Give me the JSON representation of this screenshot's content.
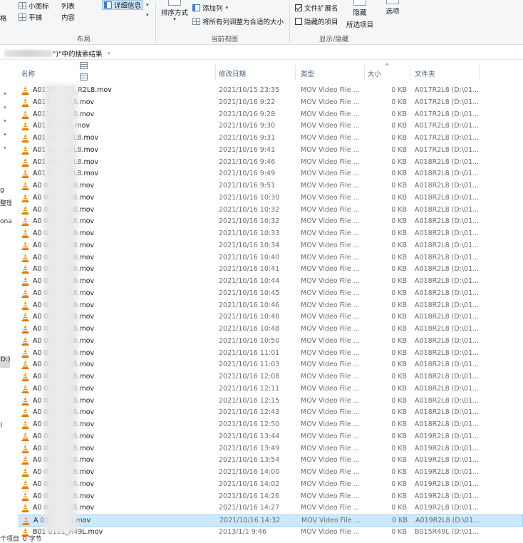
{
  "ribbon": {
    "layout_group": {
      "label": "布局",
      "small_icons": "小图标",
      "list": "列表",
      "details": "详细信息",
      "tiles": "平铺",
      "content": "内容",
      "partial_left": "格"
    },
    "current_view_group": {
      "label": "当前视图",
      "sort_by": "排序方式",
      "add_columns": "添加列",
      "size_all_columns": "将所有列调整为合适的大小"
    },
    "show_hide_group": {
      "label": "显示/隐藏",
      "file_extensions": "文件扩展名",
      "file_extensions_checked": true,
      "hidden_items": "隐藏的项目",
      "hidden_items_checked": false,
      "hide_selected": "隐藏",
      "hide_selected_sub": "所选项目",
      "options": "选项"
    }
  },
  "address": {
    "text": "\")\"中的搜索结果",
    "separator": "›"
  },
  "nav": {
    "partial_labels": [
      "g",
      "整理",
      "ona",
      "D:)",
      ")"
    ]
  },
  "columns": {
    "name": "名称",
    "date": "修改日期",
    "type": "类型",
    "size": "大小",
    "folder": "文件夹",
    "sort_indicator": "^"
  },
  "rows": [
    {
      "name": "A017C0   015_R2L8.mov",
      "date": "2021/10/15 23:35",
      "type": "MOV Video File ...",
      "size": "0 KB",
      "folder": "A017R2L8 (D:\\01..."
    },
    {
      "name": "A017   6_R2L8.mov",
      "date": "2021/10/16 9:22",
      "type": "MOV Video File ...",
      "size": "0 KB",
      "folder": "A017R2L8 (D:\\01..."
    },
    {
      "name": "A017   6_R2L8.mov",
      "date": "2021/10/16 9:28",
      "type": "MOV Video File ...",
      "size": "0 KB",
      "folder": "A017R2L8 (D:\\01..."
    },
    {
      "name": "A01   6_R2L8.mov",
      "date": "2021/10/16 9:30",
      "type": "MOV Video File ...",
      "size": "0 KB",
      "folder": "A017R2L8 (D:\\01..."
    },
    {
      "name": "A01   016_R2L8.mov",
      "date": "2021/10/16 9:31",
      "type": "MOV Video File ...",
      "size": "0 KB",
      "folder": "A017R2L8 (D:\\01..."
    },
    {
      "name": "A01   016_R2L8.mov",
      "date": "2021/10/16 9:41",
      "type": "MOV Video File ...",
      "size": "0 KB",
      "folder": "A017R2L8 (D:\\01..."
    },
    {
      "name": "A01   016_R2L8.mov",
      "date": "2021/10/16 9:46",
      "type": "MOV Video File ...",
      "size": "0 KB",
      "folder": "A018R2L8 (D:\\01..."
    },
    {
      "name": "A01   016_R2L8.mov",
      "date": "2021/10/16 9:49",
      "type": "MOV Video File ...",
      "size": "0 KB",
      "folder": "A018R2L8 (D:\\01..."
    },
    {
      "name": "A0   016_R2L8.mov",
      "date": "2021/10/16 9:51",
      "type": "MOV Video File ...",
      "size": "0 KB",
      "folder": "A018R2L8 (D:\\01..."
    },
    {
      "name": "A0   016_R2L8.mov",
      "date": "2021/10/16 10:30",
      "type": "MOV Video File ...",
      "size": "0 KB",
      "folder": "A018R2L8 (D:\\01..."
    },
    {
      "name": "A0   016_R2L8.mov",
      "date": "2021/10/16 10:32",
      "type": "MOV Video File ...",
      "size": "0 KB",
      "folder": "A018R2L8 (D:\\01..."
    },
    {
      "name": "A0   016_R2L8.mov",
      "date": "2021/10/16 10:32",
      "type": "MOV Video File ...",
      "size": "0 KB",
      "folder": "A018R2L8 (D:\\01..."
    },
    {
      "name": "A0   016_R2L8.mov",
      "date": "2021/10/16 10:33",
      "type": "MOV Video File ...",
      "size": "0 KB",
      "folder": "A018R2L8 (D:\\01..."
    },
    {
      "name": "A0   016_R2L8.mov",
      "date": "2021/10/16 10:34",
      "type": "MOV Video File ...",
      "size": "0 KB",
      "folder": "A018R2L8 (D:\\01..."
    },
    {
      "name": "A0   016_R2L8.mov",
      "date": "2021/10/16 10:40",
      "type": "MOV Video File ...",
      "size": "0 KB",
      "folder": "A018R2L8 (D:\\01..."
    },
    {
      "name": "A0   016_R2L8.mov",
      "date": "2021/10/16 10:41",
      "type": "MOV Video File ...",
      "size": "0 KB",
      "folder": "A018R2L8 (D:\\01..."
    },
    {
      "name": "A0   016_R2L8.mov",
      "date": "2021/10/16 10:44",
      "type": "MOV Video File ...",
      "size": "0 KB",
      "folder": "A018R2L8 (D:\\01..."
    },
    {
      "name": "A0   016_R2L8.mov",
      "date": "2021/10/16 10:45",
      "type": "MOV Video File ...",
      "size": "0 KB",
      "folder": "A018R2L8 (D:\\01..."
    },
    {
      "name": "A0   016_R2L8.mov",
      "date": "2021/10/16 10:46",
      "type": "MOV Video File ...",
      "size": "0 KB",
      "folder": "A018R2L8 (D:\\01..."
    },
    {
      "name": "A0   016_R2L8.mov",
      "date": "2021/10/16 10:48",
      "type": "MOV Video File ...",
      "size": "0 KB",
      "folder": "A018R2L8 (D:\\01..."
    },
    {
      "name": "A0   016_R2L8.mov",
      "date": "2021/10/16 10:48",
      "type": "MOV Video File ...",
      "size": "0 KB",
      "folder": "A018R2L8 (D:\\01..."
    },
    {
      "name": "A0   016_R2L8.mov",
      "date": "2021/10/16 10:50",
      "type": "MOV Video File ...",
      "size": "0 KB",
      "folder": "A018R2L8 (D:\\01..."
    },
    {
      "name": "A0   016_R2L8.mov",
      "date": "2021/10/16 11:01",
      "type": "MOV Video File ...",
      "size": "0 KB",
      "folder": "A018R2L8 (D:\\01..."
    },
    {
      "name": "A0   016_R2L8.mov",
      "date": "2021/10/16 11:03",
      "type": "MOV Video File ...",
      "size": "0 KB",
      "folder": "A018R2L8 (D:\\01..."
    },
    {
      "name": "A0   016_R2L8.mov",
      "date": "2021/10/16 12:08",
      "type": "MOV Video File ...",
      "size": "0 KB",
      "folder": "A018R2L8 (D:\\01..."
    },
    {
      "name": "A0   016_R2L8.mov",
      "date": "2021/10/16 12:11",
      "type": "MOV Video File ...",
      "size": "0 KB",
      "folder": "A018R2L8 (D:\\01..."
    },
    {
      "name": "A0   016_R2L8.mov",
      "date": "2021/10/16 12:15",
      "type": "MOV Video File ...",
      "size": "0 KB",
      "folder": "A018R2L8 (D:\\01..."
    },
    {
      "name": "A0   016_R2L8.mov",
      "date": "2021/10/16 12:43",
      "type": "MOV Video File ...",
      "size": "0 KB",
      "folder": "A018R2L8 (D:\\01..."
    },
    {
      "name": "A0   016_R2L8.mov",
      "date": "2021/10/16 12:50",
      "type": "MOV Video File ...",
      "size": "0 KB",
      "folder": "A018R2L8 (D:\\01..."
    },
    {
      "name": "A0   016_R2L8.mov",
      "date": "2021/10/16 13:44",
      "type": "MOV Video File ...",
      "size": "0 KB",
      "folder": "A019R2L8 (D:\\01..."
    },
    {
      "name": "A0   016_R2L8.mov",
      "date": "2021/10/16 13:49",
      "type": "MOV Video File ...",
      "size": "0 KB",
      "folder": "A019R2L8 (D:\\01..."
    },
    {
      "name": "A0   016_R2L8.mov",
      "date": "2021/10/16 13:54",
      "type": "MOV Video File ...",
      "size": "0 KB",
      "folder": "A019R2L8 (D:\\01..."
    },
    {
      "name": "A0   016_R2L8.mov",
      "date": "2021/10/16 14:00",
      "type": "MOV Video File ...",
      "size": "0 KB",
      "folder": "A019R2L8 (D:\\01..."
    },
    {
      "name": "A0   016_R2L8.mov",
      "date": "2021/10/16 14:02",
      "type": "MOV Video File ...",
      "size": "0 KB",
      "folder": "A019R2L8 (D:\\01..."
    },
    {
      "name": "A0   016_R2L8.mov",
      "date": "2021/10/16 14:26",
      "type": "MOV Video File ...",
      "size": "0 KB",
      "folder": "A019R2L8 (D:\\01..."
    },
    {
      "name": "A0   016_R2L8.mov",
      "date": "2021/10/16 14:27",
      "type": "MOV Video File ...",
      "size": "0 KB",
      "folder": "A019R2L8 (D:\\01..."
    },
    {
      "name": "A   016_R2L8.mov",
      "date": "2021/10/16 14:32",
      "type": "MOV Video File ...",
      "size": "0 KB",
      "folder": "A019R2L8 (D:\\01...",
      "selected": true
    },
    {
      "name": "B01   0101_R49L.mov",
      "date": "2013/1/1 9:46",
      "type": "MOV Video File ...",
      "size": "0 KB",
      "folder": "B015R49L (D:\\01..."
    }
  ],
  "status": {
    "items": "个项目",
    "size": "0 字节"
  },
  "colors": {
    "ribbon_bg": "#f5f6f7",
    "selected_row": "#cce8ff",
    "selected_border": "#99d1ff",
    "header_text": "#4c607a",
    "vlc_orange": "#f08a00"
  },
  "icons": {
    "file": "vlc-cone-icon",
    "pin": "pin-icon"
  }
}
